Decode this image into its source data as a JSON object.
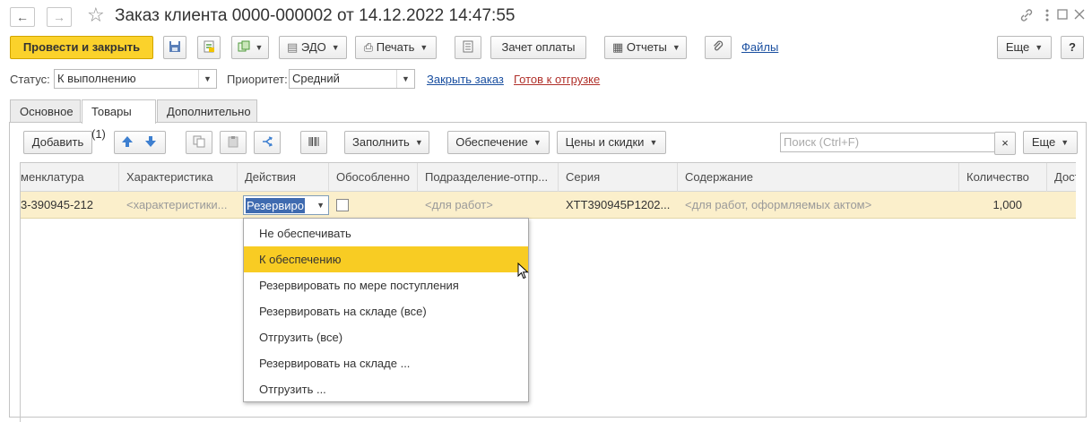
{
  "title_bar": {
    "back_icon": "arrow-left-icon",
    "forward_icon": "arrow-right-icon",
    "favorite_icon": "star-icon",
    "title": "Заказ клиента 0000-000002 от 14.12.2022 14:47:55",
    "link_icon": "link-icon",
    "more_icon": "more-vertical-icon",
    "maximize_icon": "maximize-icon",
    "close_icon": "close-icon"
  },
  "toolbar": {
    "post_close_label": "Провести и закрыть",
    "edo_label": "ЭДО",
    "print_label": "Печать",
    "offset_label": "Зачет оплаты",
    "reports_label": "Отчеты",
    "files_label": "Файлы",
    "more_label": "Еще",
    "help_label": "?"
  },
  "status_row": {
    "status_label": "Статус:",
    "status_value": "К выполнению",
    "priority_label": "Приоритет:",
    "priority_value": "Средний",
    "close_order_link": "Закрыть заказ",
    "ready_link": "Готов к отгрузке"
  },
  "tabs": [
    {
      "label": "Основное"
    },
    {
      "label": "Товары (1)"
    },
    {
      "label": "Дополнительно"
    }
  ],
  "grid_toolbar": {
    "add_label": "Добавить",
    "fill_label": "Заполнить",
    "supply_label": "Обеспечение",
    "prices_label": "Цены и скидки",
    "search_placeholder": "Поиск (Ctrl+F)",
    "clear_label": "×",
    "more_label": "Еще"
  },
  "columns": [
    {
      "label": "менклатура"
    },
    {
      "label": "Характеристика"
    },
    {
      "label": "Действия"
    },
    {
      "label": "Обособленно"
    },
    {
      "label": "Подразделение-отпр..."
    },
    {
      "label": "Серия"
    },
    {
      "label": "Содержание"
    },
    {
      "label": "Количество"
    },
    {
      "label": "Дост"
    }
  ],
  "row": {
    "nomenclature": "3-390945-212",
    "characteristic": "<характеристики...",
    "action": "Резервиро",
    "separate_checked": false,
    "department": "<для работ>",
    "series": "XTT390945P1202...",
    "content": "<для работ, оформляемых актом>",
    "quantity": "1,000"
  },
  "dropdown": {
    "selected_index": 1,
    "items": [
      "Не обеспечивать",
      "К обеспечению",
      "Резервировать по мере поступления",
      "Резервировать на складе (все)",
      "Отгрузить (все)",
      "Резервировать на складе ...",
      "Отгрузить ..."
    ]
  },
  "colors": {
    "accent": "#fbd22b",
    "link": "#1a4fa0",
    "link_alt": "#b0302a",
    "row_highlight": "#fbefcb",
    "menu_selected": "#f8cc23"
  }
}
